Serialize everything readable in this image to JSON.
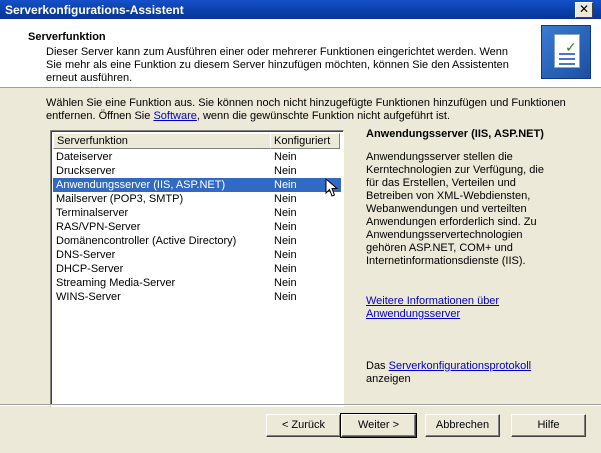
{
  "window": {
    "title": "Serverkonfigurations-Assistent",
    "close_glyph": "✕"
  },
  "header": {
    "title": "Serverfunktion",
    "description": "Dieser Server kann zum Ausführen einer oder mehrerer Funktionen eingerichtet werden. Wenn Sie mehr als eine Funktion zu diesem Server hinzufügen möchten, können Sie den Assistenten erneut ausführen."
  },
  "intro": {
    "text_before": "Wählen Sie eine Funktion aus. Sie können noch nicht hinzugefügte Funktionen hinzufügen und Funktionen entfernen. Öffnen Sie ",
    "link": "Software",
    "text_after": ", wenn die gewünschte Funktion nicht aufgeführt ist."
  },
  "list": {
    "columns": [
      "Serverfunktion",
      "Konfiguriert"
    ],
    "rows": [
      {
        "name": "Dateiserver",
        "status": "Nein"
      },
      {
        "name": "Druckserver",
        "status": "Nein"
      },
      {
        "name": "Anwendungsserver (IIS, ASP.NET)",
        "status": "Nein"
      },
      {
        "name": "Mailserver (POP3, SMTP)",
        "status": "Nein"
      },
      {
        "name": "Terminalserver",
        "status": "Nein"
      },
      {
        "name": "RAS/VPN-Server",
        "status": "Nein"
      },
      {
        "name": "Domänencontroller (Active Directory)",
        "status": "Nein"
      },
      {
        "name": "DNS-Server",
        "status": "Nein"
      },
      {
        "name": "DHCP-Server",
        "status": "Nein"
      },
      {
        "name": "Streaming Media-Server",
        "status": "Nein"
      },
      {
        "name": "WINS-Server",
        "status": "Nein"
      }
    ],
    "selected_index": 2
  },
  "info": {
    "title": "Anwendungsserver (IIS, ASP.NET)",
    "text": "Anwendungsserver stellen die Kerntechnologien zur Verfügung, die für das Erstellen, Verteilen und Betreiben von XML-Webdiensten, Webanwendungen und verteilten Anwendungen erforderlich sind. Zu Anwendungsservertechnologien gehören ASP.NET, COM+ und Internetinformationsdienste (IIS).",
    "more_link": "Weitere Informationen über Anwendungsserver",
    "log_before": "Das ",
    "log_link": "Serverkonfigurationsprotokoll",
    "log_after": " anzeigen"
  },
  "buttons": {
    "back": "< Zurück",
    "next": "Weiter >",
    "cancel": "Abbrechen",
    "help": "Hilfe"
  },
  "colors": {
    "title_bar": "#0a3fa8",
    "selection": "#316ac5",
    "link": "#0000cc",
    "dialog_bg": "#ece9d8"
  }
}
